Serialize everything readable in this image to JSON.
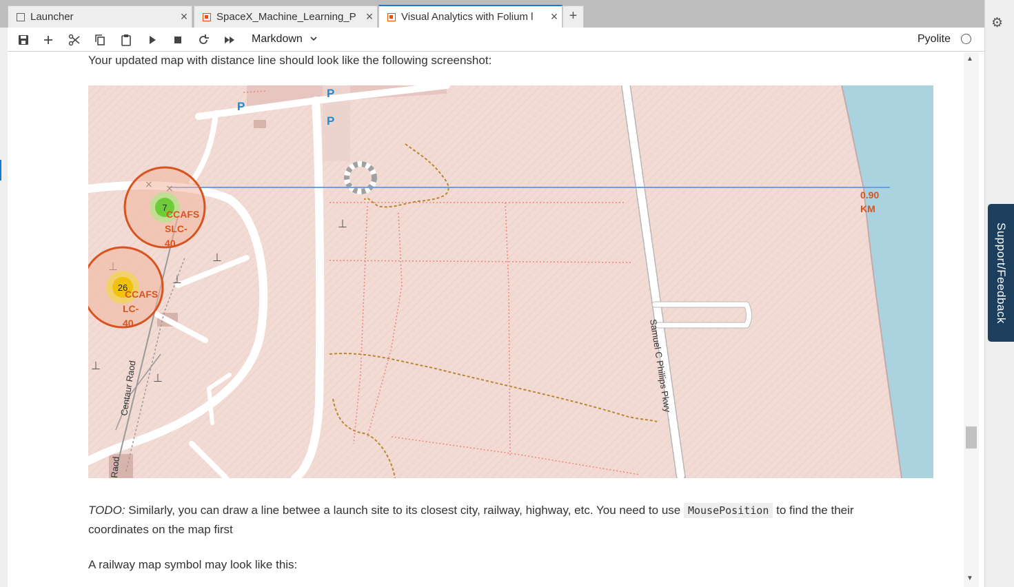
{
  "tabs": [
    {
      "label": "Launcher",
      "close": "×"
    },
    {
      "label": "SpaceX_Machine_Learning_P",
      "close": "×"
    },
    {
      "label": "Visual Analytics with Folium l",
      "close": "×"
    }
  ],
  "new_tab": "+",
  "toolbar": {
    "cell_type": "Markdown",
    "kernel": "Pyolite"
  },
  "feedback_label": "Support/Feedback",
  "content": {
    "intro": "Your updated map with distance line should look like the following screenshot:",
    "todo_prefix": "TODO:",
    "todo_text": " Similarly, you can draw a line betwee a launch site to its closest city, railway, highway, etc. You need to use ",
    "todo_code": "MousePosition",
    "todo_suffix": " to find the their",
    "todo_line2": "coordinates on the map first",
    "railway": "A railway map symbol may look like this:"
  },
  "map": {
    "clusters": [
      {
        "count": "7",
        "site_line1": "CCAFS",
        "site_line2": "SLC-",
        "site_line3": "40"
      },
      {
        "count": "26",
        "site_line1": "CCAFS",
        "site_line2": "LC-",
        "site_line3": "40"
      }
    ],
    "distance_value": "0.90",
    "distance_unit": "KM",
    "road_label": "Samuel C Phillips Pkwy",
    "road_label_2": "Centaur Raod",
    "road_label_3": "Raod",
    "parking": "P",
    "colors": {
      "land": "#f2dbd4",
      "water": "#aad3df",
      "line": "#6c9ee8",
      "cluster_ring": "#d9531e"
    }
  }
}
